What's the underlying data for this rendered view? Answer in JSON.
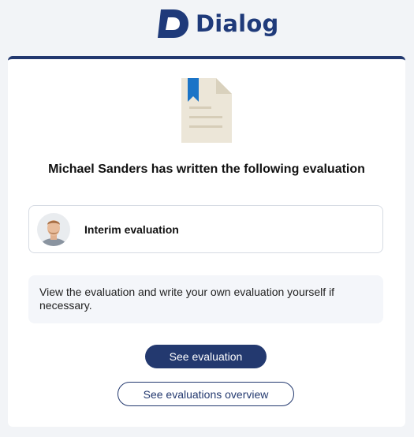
{
  "brand": {
    "name": "Dialog",
    "logo_icon": "dialog-d-logo",
    "color": "#1f3a7a"
  },
  "card": {
    "document_icon": "document-bookmark-icon",
    "heading": "Michael Sanders has written the following evaluation",
    "evaluation": {
      "avatar": "user-avatar",
      "title": "Interim evaluation"
    },
    "info_text": "View the evaluation and write your own evaluation yourself if necessary.",
    "primary_button": "See evaluation",
    "secondary_button": "See evaluations overview"
  },
  "colors": {
    "accent": "#23396f",
    "background": "#f2f4f7",
    "bookmark": "#1b74c7"
  }
}
